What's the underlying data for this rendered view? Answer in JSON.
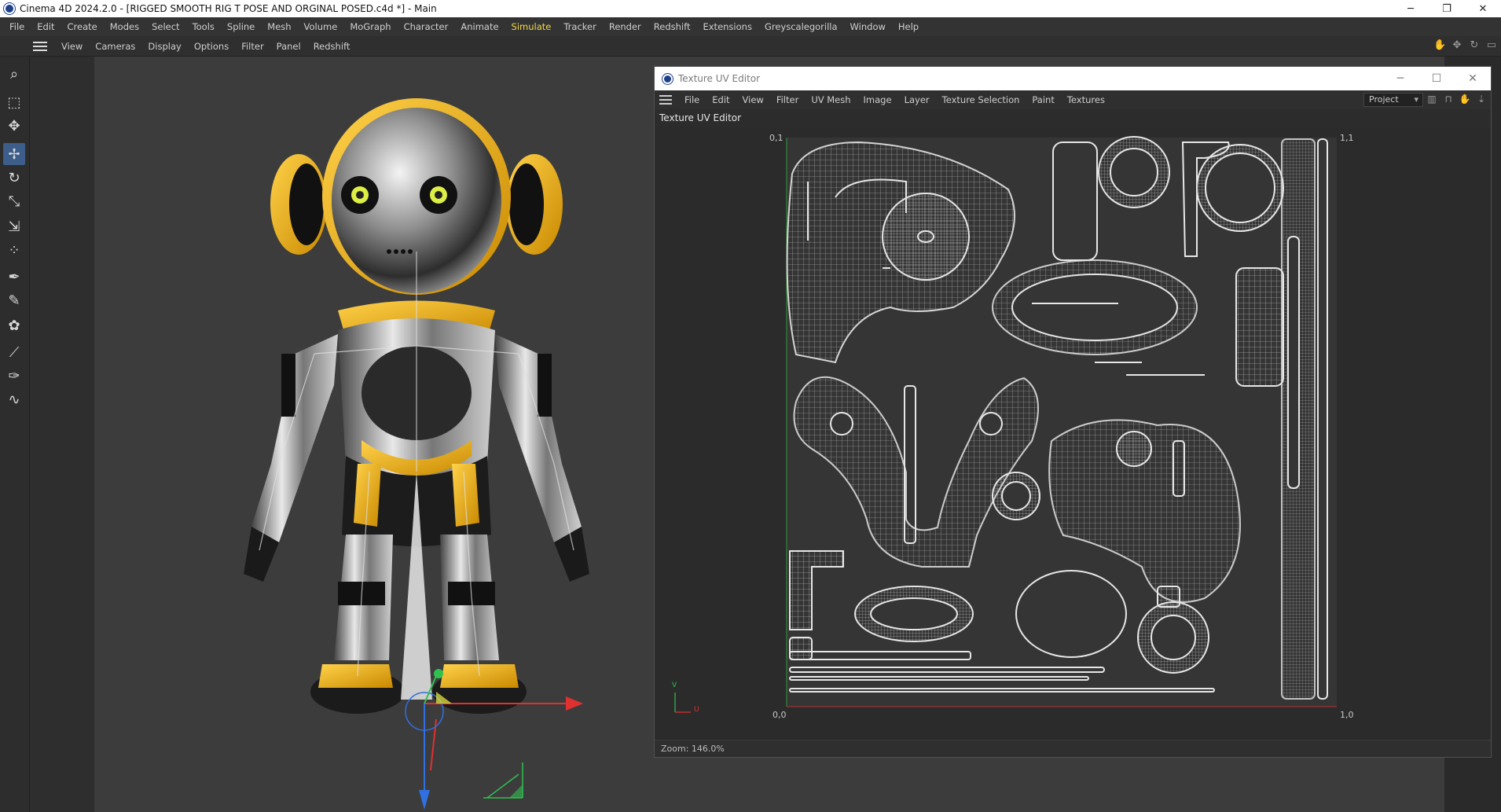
{
  "window": {
    "title": "Cinema 4D 2024.2.0 - [RIGGED SMOOTH RIG T POSE AND ORGINAL POSED.c4d *] - Main",
    "controls": [
      "─",
      "❐",
      "✕"
    ]
  },
  "main_menu": [
    "File",
    "Edit",
    "Create",
    "Modes",
    "Select",
    "Tools",
    "Spline",
    "Mesh",
    "Volume",
    "MoGraph",
    "Character",
    "Animate",
    "Simulate",
    "Tracker",
    "Render",
    "Redshift",
    "Extensions",
    "Greyscalegorilla",
    "Window",
    "Help"
  ],
  "main_menu_active": "Simulate",
  "viewport_menu": [
    "View",
    "Cameras",
    "Display",
    "Options",
    "Filter",
    "Panel",
    "Redshift"
  ],
  "left_tools": [
    {
      "icon": "search-icon",
      "glyph": "⌕"
    },
    {
      "icon": "selection-icon",
      "glyph": "⬚"
    },
    {
      "icon": "live-selection-icon",
      "glyph": "✥"
    },
    {
      "icon": "move-icon",
      "glyph": "✢",
      "active": true
    },
    {
      "icon": "rotate-icon",
      "glyph": "↻"
    },
    {
      "icon": "scale-icon",
      "glyph": "⤡"
    },
    {
      "icon": "transform-icon",
      "glyph": "⇲"
    },
    {
      "icon": "points-icon",
      "glyph": "⁘"
    },
    {
      "icon": "spline-pen-icon",
      "glyph": "✒"
    },
    {
      "icon": "paint-icon",
      "glyph": "✎"
    },
    {
      "icon": "polygon-pen-icon",
      "glyph": "✿"
    },
    {
      "icon": "brush-icon",
      "glyph": "⟋"
    },
    {
      "icon": "knife-icon",
      "glyph": "✑"
    },
    {
      "icon": "bend-icon",
      "glyph": "∿"
    }
  ],
  "uv_editor": {
    "title": "Texture UV Editor",
    "panel_title": "Texture UV Editor",
    "menu": [
      "File",
      "Edit",
      "View",
      "Filter",
      "UV Mesh",
      "Image",
      "Layer",
      "Texture Selection",
      "Paint",
      "Textures"
    ],
    "dropdown": "Project",
    "corners": {
      "tl": "0,1",
      "tr": "1,1",
      "bl": "0,0",
      "br": "1,0"
    },
    "axis_v": "V",
    "axis_u": "U",
    "zoom_text": "Zoom: 146.0%"
  },
  "colors": {
    "accent_menu": "#f2d84a",
    "active_tool": "#3d5d8a",
    "uv_lines": "#d8d8d8",
    "axis_x": "#e03030",
    "axis_y": "#30c050",
    "axis_z": "#3070e0"
  }
}
